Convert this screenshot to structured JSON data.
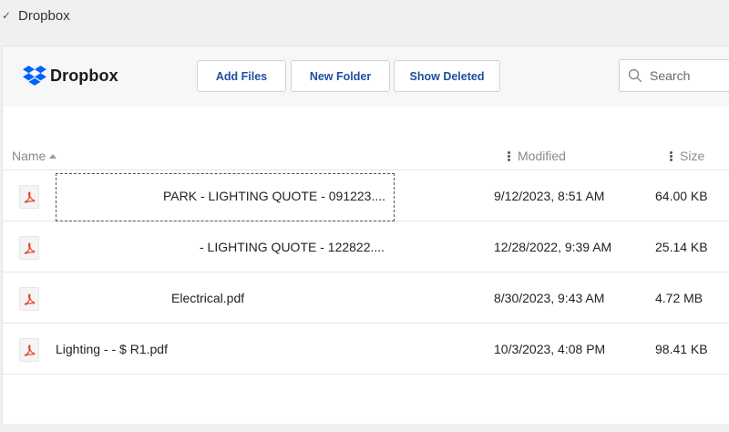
{
  "window": {
    "title": "Dropbox",
    "check": "✓"
  },
  "brand": {
    "name": "Dropbox",
    "color": "#0061fe"
  },
  "toolbar": {
    "add_files": "Add Files",
    "new_folder": "New Folder",
    "show_deleted": "Show Deleted"
  },
  "search": {
    "placeholder": "Search",
    "icon": "search-icon"
  },
  "columns": {
    "name": "Name",
    "modified": "Modified",
    "size": "Size"
  },
  "files": [
    {
      "name": "PARK - LIGHTING QUOTE - 091223....",
      "modified": "9/12/2023, 8:51 AM",
      "size": "64.00 KB",
      "icon": "pdf-icon"
    },
    {
      "name": "- LIGHTING QUOTE - 122822....",
      "modified": "12/28/2022, 9:39 AM",
      "size": "25.14 KB",
      "icon": "pdf-icon"
    },
    {
      "name": "Electrical.pdf",
      "modified": "8/30/2023, 9:43 AM",
      "size": "4.72 MB",
      "icon": "pdf-icon"
    },
    {
      "name": "Lighting -   - $     R1.pdf",
      "modified": "10/3/2023, 4:08 PM",
      "size": "98.41 KB",
      "icon": "pdf-icon"
    }
  ],
  "colors": {
    "pdf_red": "#e8412c",
    "button_text": "#1e4f9c"
  }
}
